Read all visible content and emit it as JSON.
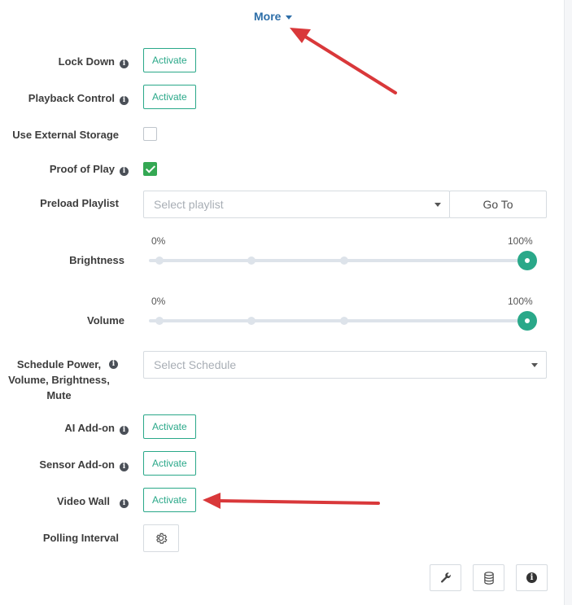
{
  "more": {
    "label": "More"
  },
  "fields": {
    "lock_down": {
      "label": "Lock Down",
      "button": "Activate"
    },
    "playback_control": {
      "label": "Playback Control",
      "button": "Activate"
    },
    "external_storage": {
      "label": "Use External Storage",
      "checked": false
    },
    "proof_of_play": {
      "label": "Proof of Play",
      "checked": true
    },
    "preload_playlist": {
      "label": "Preload Playlist",
      "placeholder": "Select playlist",
      "goto_label": "Go To"
    },
    "brightness": {
      "label": "Brightness",
      "min_label": "0%",
      "max_label": "100%",
      "value_percent": 100
    },
    "volume": {
      "label": "Volume",
      "min_label": "0%",
      "max_label": "100%",
      "value_percent": 100
    },
    "schedule": {
      "label": "Schedule Power, Volume, Brightness, Mute",
      "placeholder": "Select Schedule"
    },
    "ai_addon": {
      "label": "AI Add-on",
      "button": "Activate"
    },
    "sensor_addon": {
      "label": "Sensor Add-on",
      "button": "Activate"
    },
    "video_wall": {
      "label": "Video Wall",
      "button": "Activate"
    },
    "polling_interval": {
      "label": "Polling Interval"
    }
  },
  "toolbar": {
    "icons": [
      "wrench-icon",
      "database-icon",
      "info-icon"
    ]
  },
  "colors": {
    "accent": "#2aa889",
    "link": "#2d6ea8",
    "check": "#34a853",
    "annotation": "#d9383a"
  }
}
